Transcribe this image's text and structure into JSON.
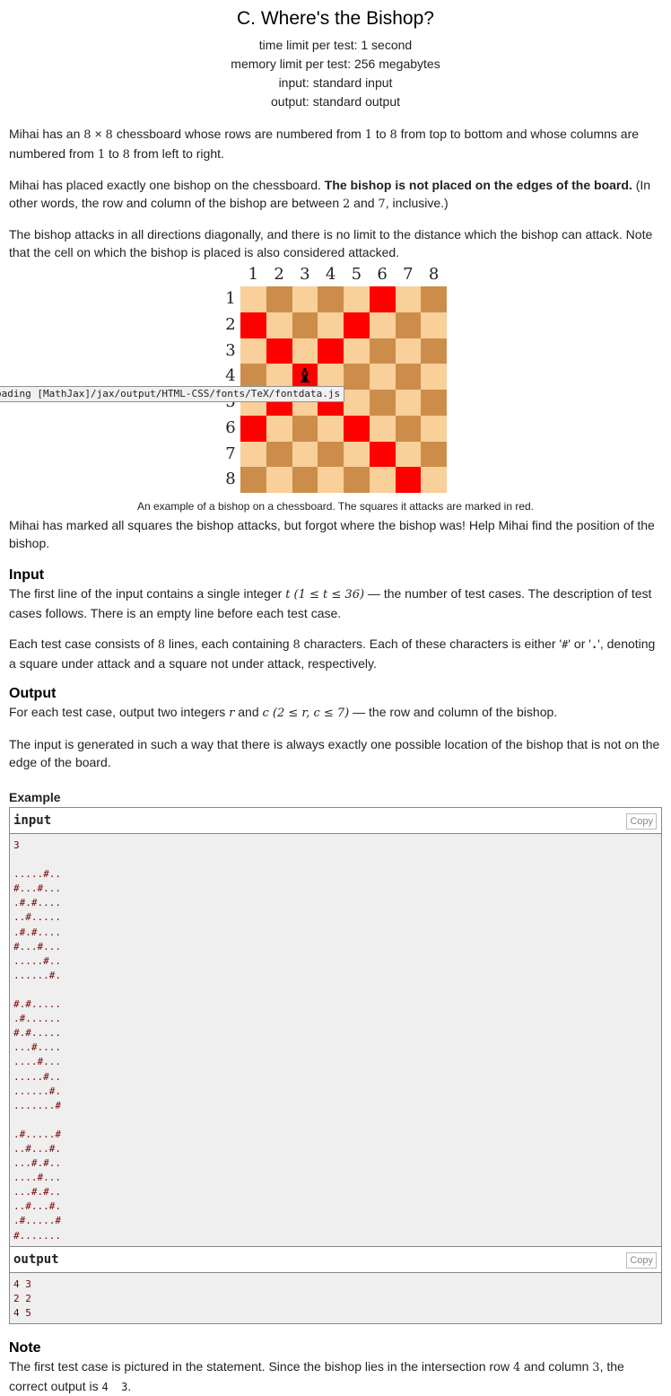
{
  "header": {
    "title": "C. Where's the Bishop?",
    "time_limit": "time limit per test: 1 second",
    "memory_limit": "memory limit per test: 256 megabytes",
    "input": "input: standard input",
    "output": "output: standard output"
  },
  "statement": {
    "p1_a": "Mihai has an ",
    "p1_8a": "8",
    "p1_x": " × ",
    "p1_8b": "8",
    "p1_b": " chessboard whose rows are numbered from ",
    "p1_1a": "1",
    "p1_c": " to ",
    "p1_8c": "8",
    "p1_d": " from top to bottom and whose columns are numbered from ",
    "p1_1b": "1",
    "p1_e": " to ",
    "p1_8d": "8",
    "p1_f": " from left to right.",
    "p2_a": "Mihai has placed exactly one bishop on the chessboard. ",
    "p2_bold": "The bishop is not placed on the edges of the board.",
    "p2_b": " (In other words, the row and column of the bishop are between ",
    "p2_2": "2",
    "p2_c": " and ",
    "p2_7": "7",
    "p2_d": ", inclusive.)",
    "p3": "The bishop attacks in all directions diagonally, and there is no limit to the distance which the bishop can attack. Note that the cell on which the bishop is placed is also considered attacked.",
    "caption": "An example of a bishop on a chessboard. The squares it attacks are marked in red.",
    "p4": "Mihai has marked all squares the bishop attacks, but forgot where the bishop was! Help Mihai find the position of the bishop."
  },
  "board": {
    "col_labels": [
      "1",
      "2",
      "3",
      "4",
      "5",
      "6",
      "7",
      "8"
    ],
    "row_labels": [
      "1",
      "2",
      "3",
      "4",
      "5",
      "6",
      "7",
      "8"
    ],
    "rows": [
      "L D L D L R L D",
      "R L D L R L D L",
      "L R L R L D L D",
      "D L B L D L D L",
      "L R L R L D L D",
      "R L D L R L D L",
      "L D L D L R L D",
      "D L D L D L R L"
    ],
    "bishop_glyph": "♝",
    "colors": {
      "light": "#f9cf9a",
      "dark": "#cd8d4a",
      "attacked": "#ff0000"
    }
  },
  "tooltip": "oading [MathJax]/jax/output/HTML-CSS/fonts/TeX/fontdata.js",
  "input_section": {
    "title": "Input",
    "p1_a": "The first line of the input contains a single integer ",
    "p1_math": "t (1 ≤ t ≤ 36)",
    "p1_b": " — the number of test cases. The description of test cases follows. There is an empty line before each test case.",
    "p2_a": "Each test case consists of ",
    "p2_8a": "8",
    "p2_b": " lines, each containing ",
    "p2_8b": "8",
    "p2_c": " characters. Each of these characters is either '",
    "p2_hash": "#",
    "p2_d": "' or '",
    "p2_dot": ".",
    "p2_e": "', denoting a square under attack and a square not under attack, respectively."
  },
  "output_section": {
    "title": "Output",
    "p1_a": "For each test case, output two integers ",
    "p1_r": "r",
    "p1_and": " and ",
    "p1_c": "c",
    "p1_math": " (2 ≤ r, c ≤ 7)",
    "p1_b": " — the row and column of the bishop.",
    "p2": "The input is generated in such a way that there is always exactly one possible location of the bishop that is not on the edge of the board."
  },
  "example": {
    "title": "Example",
    "input_label": "input",
    "output_label": "output",
    "copy_label": "Copy",
    "input_text": "3\n\n.....#..\n#...#...\n.#.#....\n..#.....\n.#.#....\n#...#...\n.....#..\n......#.\n\n#.#.....\n.#......\n#.#.....\n...#....\n....#...\n.....#..\n......#.\n.......#\n\n.#.....#\n..#...#.\n...#.#..\n....#...\n...#.#..\n..#...#.\n.#.....#\n#.......",
    "output_text": "4 3\n2 2\n4 5"
  },
  "note": {
    "title": "Note",
    "p_a": "The first test case is pictured in the statement. Since the bishop lies in the intersection row ",
    "p_4": "4",
    "p_b": " and column ",
    "p_3": "3",
    "p_c": ", the correct output is ",
    "p_code": "4  3",
    "p_d": "."
  }
}
